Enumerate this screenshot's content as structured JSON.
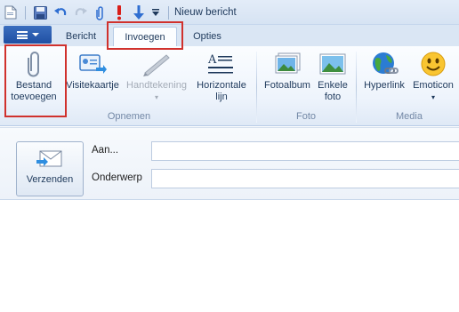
{
  "window": {
    "title": "Nieuw bericht"
  },
  "qat": {
    "icons": [
      "document-icon",
      "save-icon",
      "undo-icon",
      "redo-icon",
      "paperclip-icon",
      "priority-high-icon",
      "priority-low-icon",
      "customize-dropdown-icon"
    ]
  },
  "tabs": [
    {
      "label": "Bericht"
    },
    {
      "label": "Invoegen"
    },
    {
      "label": "Opties"
    }
  ],
  "active_tab": "Invoegen",
  "ribbon": {
    "groups": [
      {
        "label": "Opnemen"
      },
      {
        "label": "Foto"
      },
      {
        "label": "Media"
      }
    ],
    "buttons": {
      "attach": {
        "line1": "Bestand",
        "line2": "toevoegen"
      },
      "business_card": {
        "line1": "Visitekaartje"
      },
      "signature": {
        "line1": "Handtekening",
        "disabled": true
      },
      "horizontal_line": {
        "line1": "Horizontale",
        "line2": "lijn"
      },
      "photo_album": {
        "line1": "Fotoalbum"
      },
      "single_photo": {
        "line1": "Enkele",
        "line2": "foto"
      },
      "hyperlink": {
        "line1": "Hyperlink"
      },
      "emoticon": {
        "line1": "Emoticon"
      }
    }
  },
  "compose": {
    "send_label": "Verzenden",
    "to_label": "Aan...",
    "to_value": "",
    "subject_label": "Onderwerp",
    "subject_value": ""
  },
  "colors": {
    "highlight": "#d0312d",
    "accent": "#1f4fa3"
  }
}
